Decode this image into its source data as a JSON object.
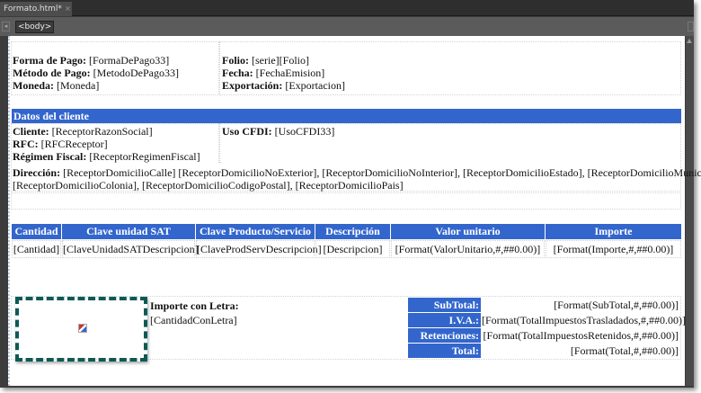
{
  "editor": {
    "tab_title": "Formato.html*",
    "tab_close": "×",
    "breadcrumb_tag": "<body>"
  },
  "header": {
    "forma_pago_label": "Forma de Pago:",
    "forma_pago_value": "[FormaDePago33]",
    "metodo_pago_label": "Método de Pago:",
    "metodo_pago_value": "[MetodoDePago33]",
    "moneda_label": "Moneda:",
    "moneda_value": "[Moneda]",
    "folio_label": "Folio:",
    "folio_value": "[serie][Folio]",
    "fecha_label": "Fecha:",
    "fecha_value": "[FechaEmision]",
    "exportacion_label": "Exportación:",
    "exportacion_value": "[Exportacion]"
  },
  "cliente": {
    "section_title": "Datos del cliente",
    "cliente_label": "Cliente:",
    "cliente_value": "[ReceptorRazonSocial]",
    "rfc_label": "RFC:",
    "rfc_value": "[RFCReceptor]",
    "regimen_label": "Régimen Fiscal:",
    "regimen_value": "[ReceptorRegimenFiscal]",
    "uso_label": "Uso CFDI:",
    "uso_value": "[UsoCFDI33]",
    "direccion_label": "Dirección:",
    "direccion_line1": "[ReceptorDomicilioCalle] [ReceptorDomicilioNoExterior], [ReceptorDomicilioNoInterior], [ReceptorDomicilioEstado], [ReceptorDomicilioMunicipio],",
    "direccion_line2": "[ReceptorDomicilioColonia], [ReceptorDomicilioCodigoPostal], [ReceptorDomicilioPais]"
  },
  "table": {
    "headers": [
      "Cantidad",
      "Clave unidad SAT",
      "Clave Producto/Servicio",
      "Descripción",
      "Valor unitario",
      "Importe"
    ],
    "row": [
      "[Cantidad]",
      "[ClaveUnidadSATDescripcion]",
      "[ClaveProdServDescripcion]",
      "[Descripcion]",
      "[Format(ValorUnitario,#,##0.00)]",
      "[Format(Importe,#,##0.00)]"
    ]
  },
  "totals": {
    "importe_letra_label": "Importe con Letra:",
    "importe_letra_value": "[CantidadConLetra]",
    "rows": [
      {
        "label": "SubTotal:",
        "value": "[Format(SubTotal,#,##0.00)]"
      },
      {
        "label": "I.V.A.:",
        "value": "[Format(TotalImpuestosTrasladados,#,##0.00)]"
      },
      {
        "label": "Retenciones:",
        "value": "[Format(TotalImpuestosRetenidos,#,##0.00)]"
      },
      {
        "label": "Total:",
        "value": "[Format(Total,#,##0.00)]"
      }
    ]
  },
  "colors": {
    "accent": "#3366cc",
    "selection": "#0d5a55"
  }
}
